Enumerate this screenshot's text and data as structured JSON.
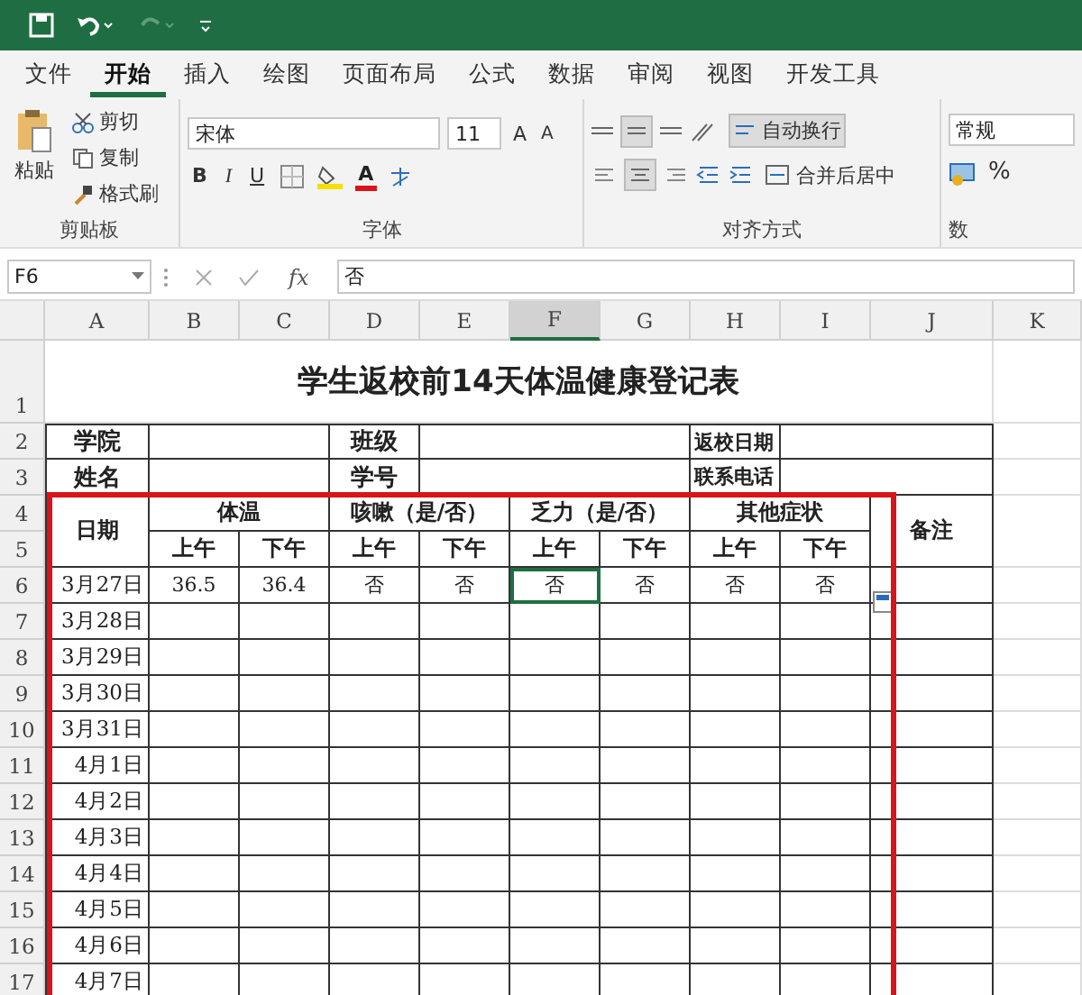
{
  "tabs": [
    {
      "label": "文件",
      "selected": false
    },
    {
      "label": "开始",
      "selected": true
    },
    {
      "label": "插入",
      "selected": false
    },
    {
      "label": "绘图",
      "selected": false
    },
    {
      "label": "页面布局",
      "selected": false
    },
    {
      "label": "公式",
      "selected": false
    },
    {
      "label": "数据",
      "selected": false
    },
    {
      "label": "审阅",
      "selected": false
    },
    {
      "label": "视图",
      "selected": false
    },
    {
      "label": "开发工具",
      "selected": false
    }
  ],
  "ribbon": {
    "clipboard": {
      "label": "剪贴板",
      "paste": "粘贴",
      "cut": "剪切",
      "copy": "复制",
      "format_painter": "格式刷"
    },
    "font": {
      "label": "字体",
      "font_name": "宋体",
      "font_size": "11",
      "grow": "A",
      "shrink": "A",
      "bold": "B",
      "italic": "I",
      "underline": "U",
      "font_color": "A"
    },
    "alignment": {
      "label": "对齐方式",
      "wrap_text": "自动换行",
      "wrap_selected": true,
      "merge_center": "合并后居中"
    },
    "number": {
      "label": "数",
      "format": "常规",
      "percent": "%"
    }
  },
  "formula_bar": {
    "name_box": "F6",
    "fx": "fx",
    "formula": "否"
  },
  "sheet": {
    "columns": [
      {
        "label": "A",
        "selected": false
      },
      {
        "label": "B",
        "selected": false
      },
      {
        "label": "C",
        "selected": false
      },
      {
        "label": "D",
        "selected": false
      },
      {
        "label": "E",
        "selected": false
      },
      {
        "label": "F",
        "selected": true
      },
      {
        "label": "G",
        "selected": false
      },
      {
        "label": "H",
        "selected": false
      },
      {
        "label": "I",
        "selected": false
      },
      {
        "label": "J",
        "selected": false
      },
      {
        "label": "K",
        "selected": false
      }
    ],
    "rows": [
      {
        "number": "1",
        "kind": "title",
        "text": "学生返校前14天体温健康登记表"
      },
      {
        "number": "2",
        "kind": "info",
        "labels": [
          "学院",
          "班级",
          "返校日期"
        ]
      },
      {
        "number": "3",
        "kind": "info",
        "labels": [
          "姓名",
          "学号",
          "联系电话"
        ]
      },
      {
        "number": "4",
        "kind": "group_header",
        "date_label": "日期",
        "groups": [
          "体温",
          "咳嗽（是/否）",
          "乏力（是/否）",
          "其他症状"
        ],
        "note_label": "备注"
      },
      {
        "number": "5",
        "kind": "sub_header",
        "labels": [
          "上午",
          "下午",
          "上午",
          "下午",
          "上午",
          "下午",
          "上午",
          "下午"
        ]
      },
      {
        "number": "6",
        "kind": "data",
        "date": "3月27日",
        "values": [
          {
            "text": "36.5",
            "selected": false
          },
          {
            "text": "36.4",
            "selected": false
          },
          {
            "text": "否",
            "selected": false
          },
          {
            "text": "否",
            "selected": false
          },
          {
            "text": "否",
            "selected": true
          },
          {
            "text": "否",
            "selected": false
          },
          {
            "text": "否",
            "selected": false
          },
          {
            "text": "否",
            "selected": false
          }
        ]
      },
      {
        "number": "7",
        "kind": "data",
        "date": "3月28日",
        "paste_options": true
      },
      {
        "number": "8",
        "kind": "data",
        "date": "3月29日"
      },
      {
        "number": "9",
        "kind": "data",
        "date": "3月30日"
      },
      {
        "number": "10",
        "kind": "data",
        "date": "3月31日"
      },
      {
        "number": "11",
        "kind": "data",
        "date": "4月1日"
      },
      {
        "number": "12",
        "kind": "data",
        "date": "4月2日"
      },
      {
        "number": "13",
        "kind": "data",
        "date": "4月3日"
      },
      {
        "number": "14",
        "kind": "data",
        "date": "4月4日"
      },
      {
        "number": "15",
        "kind": "data",
        "date": "4月5日"
      },
      {
        "number": "16",
        "kind": "data",
        "date": "4月6日"
      },
      {
        "number": "17",
        "kind": "data",
        "date": "4月7日"
      }
    ]
  }
}
